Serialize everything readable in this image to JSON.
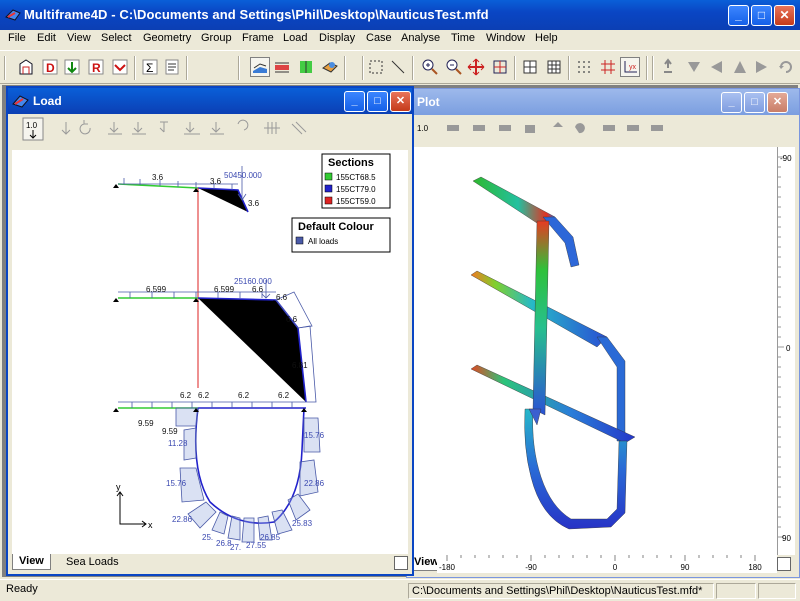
{
  "app": {
    "title": "Multiframe4D - C:\\Documents and Settings\\Phil\\Desktop\\NauticusTest.mfd",
    "controls": {
      "minimize": "_",
      "maximize": "□",
      "close": "✕"
    }
  },
  "menu": [
    "File",
    "Edit",
    "View",
    "Select",
    "Geometry",
    "Group",
    "Frame",
    "Load",
    "Display",
    "Case",
    "Analyse",
    "Time",
    "Window",
    "Help"
  ],
  "toolbar": {
    "icons": [
      "new-icon",
      "dead-load-icon",
      "live-load-icon",
      "result-icon",
      "combination-icon",
      "sum-icon",
      "report-icon",
      "frame-view-icon",
      "section-view-icon",
      "member-view-icon",
      "render-view-icon",
      "select-box-icon",
      "select-line-icon",
      "zoom-in-icon",
      "zoom-out-icon",
      "pan-icon",
      "zoom-extents-icon",
      "grid-icon",
      "grid2-icon",
      "snap-grid-icon",
      "coordinates-icon",
      "axes-icon",
      "support-icon",
      "load-arrow-icon",
      "triangle-icon",
      "arrow-right-icon",
      "rotate-icon"
    ]
  },
  "load_window": {
    "title": "Load",
    "toolbar_first": "1.0",
    "tabs": [
      {
        "label": "View"
      },
      {
        "label": "Sea Loads"
      }
    ],
    "legend_sections": {
      "title": "Sections",
      "items": [
        {
          "label": "155CT68.5",
          "color": "#33cc33"
        },
        {
          "label": "155CT79.0",
          "color": "#2222cc"
        },
        {
          "label": "155CT59.0",
          "color": "#dd2222"
        }
      ]
    },
    "legend_colour": {
      "title": "Default Colour",
      "items": [
        {
          "label": "All loads",
          "color": "#4a5aa8"
        }
      ]
    },
    "axes": {
      "x": "x",
      "y": "y"
    },
    "load_labels": {
      "top_a": "3.6",
      "top_b": "3.6",
      "top_c": "3.6",
      "top_node": "50450.000",
      "mid_a": "6.599",
      "mid_b": "6.599",
      "mid_c": "6.6",
      "mid_d": "6.6",
      "mid_e": "6.6",
      "mid_f": "6.81",
      "mid_node": "25160.000",
      "low_a": "6.2",
      "low_b": "6.2",
      "low_c": "6.2",
      "low_d": "6.2",
      "hull_a": "9.59",
      "hull_b": "9.59",
      "hull_c": "11.28",
      "hull_d": "15.76",
      "hull_e": "15.76",
      "hull_f": "22.86",
      "hull_g": "22.86",
      "hull_h": "25.83",
      "hull_i": "25.",
      "hull_j": "26.85",
      "hull_k": "26.8",
      "hull_l": "27.",
      "hull_m": "27.55"
    }
  },
  "plot_window": {
    "title": "Plot",
    "ruler_labels": [
      "-180",
      "-90",
      "0",
      "90",
      "180"
    ],
    "vruler_labels": [
      "-90",
      "0",
      "90"
    ],
    "tabs": [
      {
        "label": "View"
      }
    ],
    "toolbar_first": "1.0"
  },
  "status": {
    "ready": "Ready",
    "path": "C:\\Documents and Settings\\Phil\\Desktop\\NauticusTest.mfd*"
  }
}
